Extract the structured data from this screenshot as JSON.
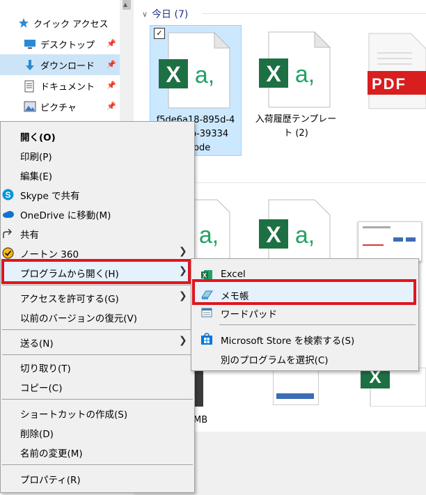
{
  "nav": {
    "items": [
      {
        "label": "クイック アクセス",
        "icon": "star-icon"
      },
      {
        "label": "デスクトップ",
        "icon": "desktop-icon"
      },
      {
        "label": "ダウンロード",
        "icon": "download-icon"
      },
      {
        "label": "ドキュメント",
        "icon": "document-icon"
      },
      {
        "label": "ピクチャ",
        "icon": "picture-icon"
      }
    ]
  },
  "files": {
    "group_label": "今日 (7)",
    "tiles": [
      {
        "name_line1": "f5de6a18-895d-4",
        "name_line2": "b-39334",
        "name_line3": "abde"
      },
      {
        "name_line1": "入荷履歴テンプレー",
        "name_line2": "ト (2)"
      },
      {
        "name_line1": "PDF"
      }
    ],
    "bottom_caption": "MB"
  },
  "context_menu": {
    "items": [
      {
        "label": "開く(O)"
      },
      {
        "label": "印刷(P)"
      },
      {
        "label": "編集(E)"
      },
      {
        "label": "Skype で共有"
      },
      {
        "label": "OneDrive に移動(M)"
      },
      {
        "label": "共有"
      },
      {
        "label": "ノートン 360"
      },
      {
        "label": "プログラムから開く(H)"
      },
      {
        "label": "アクセスを許可する(G)"
      },
      {
        "label": "以前のバージョンの復元(V)"
      },
      {
        "label": "送る(N)"
      },
      {
        "label": "切り取り(T)"
      },
      {
        "label": "コピー(C)"
      },
      {
        "label": "ショートカットの作成(S)"
      },
      {
        "label": "削除(D)"
      },
      {
        "label": "名前の変更(M)"
      },
      {
        "label": "プロパティ(R)"
      }
    ]
  },
  "submenu": {
    "items": [
      {
        "label": "Excel"
      },
      {
        "label": "メモ帳"
      },
      {
        "label": "ワードパッド"
      },
      {
        "label": "Microsoft Store を検索する(S)"
      },
      {
        "label": "別のプログラムを選択(C)"
      }
    ]
  },
  "colors": {
    "highlight": "#e1141e",
    "excel_green": "#1d7044",
    "accent": "#0078d7"
  }
}
